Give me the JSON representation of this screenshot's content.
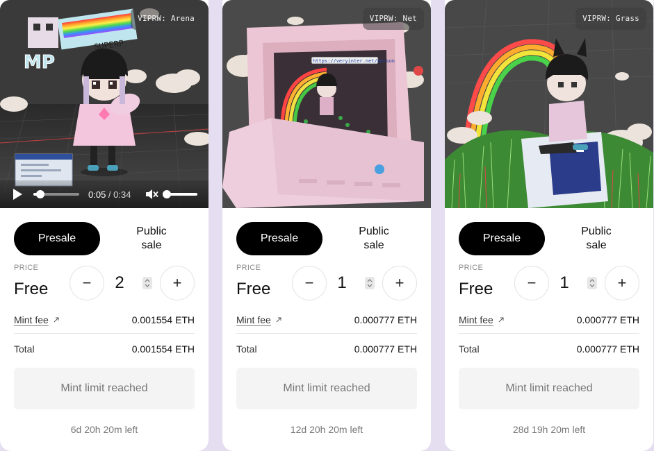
{
  "cards": [
    {
      "badge": "VIPRW: Arena",
      "scene_texts": [
        "SUPERP",
        "MP"
      ],
      "video": {
        "current_time": "0:05",
        "separator": " / ",
        "duration": "0:34",
        "progress_fraction": 0.15,
        "volume_fraction": 0,
        "muted": true
      },
      "tabs": {
        "presale": "Presale",
        "public_sale": "Public sale",
        "active": "presale"
      },
      "price_label": "PRICE",
      "price_value": "Free",
      "quantity": "2",
      "mint_fee_label": "Mint fee",
      "mint_fee_value": "0.001554 ETH",
      "total_label": "Total",
      "total_value": "0.001554 ETH",
      "mint_button": "Mint limit reached",
      "time_left": "6d 20h 20m left"
    },
    {
      "badge": "VIPRW: Net",
      "scene_texts": [
        "https://veryinter.net/person"
      ],
      "tabs": {
        "presale": "Presale",
        "public_sale": "Public sale",
        "active": "presale"
      },
      "price_label": "PRICE",
      "price_value": "Free",
      "quantity": "1",
      "mint_fee_label": "Mint fee",
      "mint_fee_value": "0.000777 ETH",
      "total_label": "Total",
      "total_value": "0.000777 ETH",
      "mint_button": "Mint limit reached",
      "time_left": "12d 20h 20m left"
    },
    {
      "badge": "VIPRW: Grass",
      "tabs": {
        "presale": "Presale",
        "public_sale": "Public sale",
        "active": "presale"
      },
      "price_label": "PRICE",
      "price_value": "Free",
      "quantity": "1",
      "mint_fee_label": "Mint fee",
      "mint_fee_value": "0.000777 ETH",
      "total_label": "Total",
      "total_value": "0.000777 ETH",
      "mint_button": "Mint limit reached",
      "time_left": "28d 19h 20m left"
    }
  ],
  "icons": {
    "play": "play-icon",
    "mute": "muted-speaker-icon",
    "minus": "minus-icon",
    "plus": "plus-icon",
    "spinner": "spinner-arrows-icon",
    "external": "external-link-arrow-icon",
    "minus_glyph": "−",
    "plus_glyph": "+"
  },
  "colors": {
    "page_background": "#e4def0",
    "card_background": "#ffffff",
    "active_tab": "#000000",
    "disabled_button": "#f4f4f4",
    "muted_text": "#777777"
  }
}
